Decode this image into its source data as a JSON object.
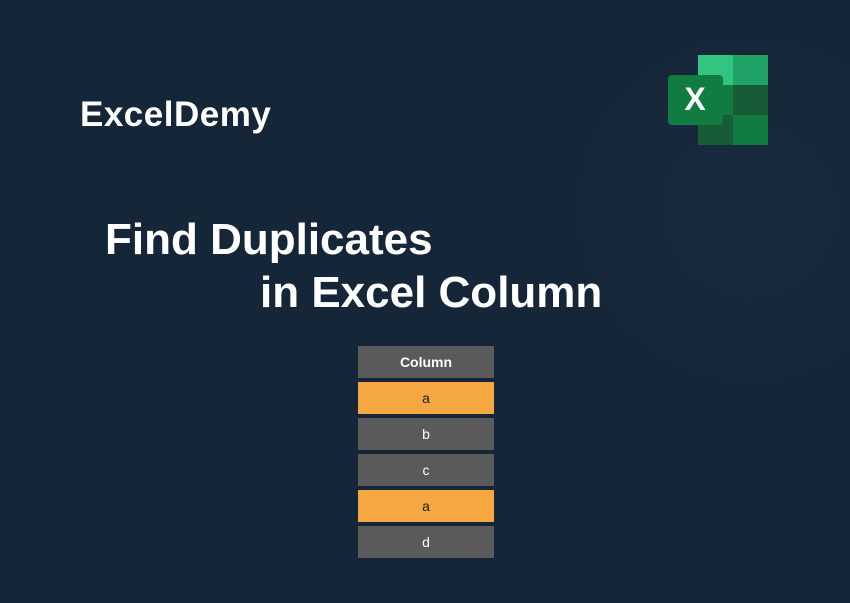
{
  "brand": "ExcelDemy",
  "title": {
    "line1": "Find Duplicates",
    "line2": "in Excel Column"
  },
  "table": {
    "header": "Column",
    "rows": [
      {
        "value": "a",
        "highlight": true
      },
      {
        "value": "b",
        "highlight": false
      },
      {
        "value": "c",
        "highlight": false
      },
      {
        "value": "a",
        "highlight": true
      },
      {
        "value": "d",
        "highlight": false
      }
    ]
  },
  "icon": {
    "name": "excel-icon"
  }
}
